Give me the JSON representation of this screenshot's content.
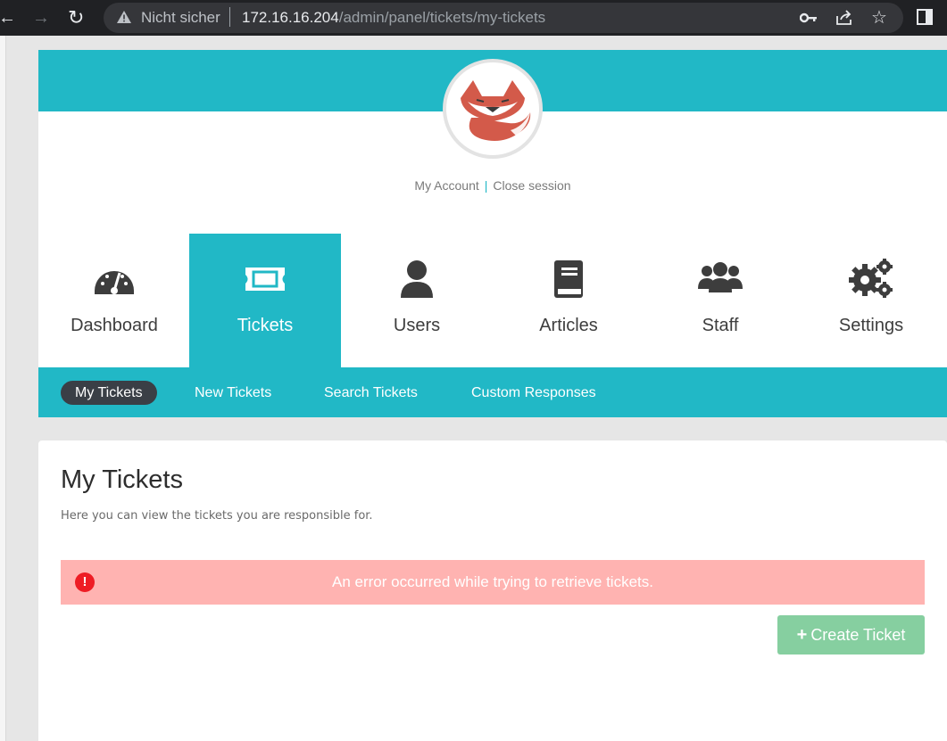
{
  "browser": {
    "security_text": "Nicht sicher",
    "url_host": "172.16.16.204",
    "url_path": "/admin/panel/tickets/my-tickets"
  },
  "account": {
    "my_account": "My Account",
    "divider": "|",
    "close_session": "Close session"
  },
  "nav": {
    "items": [
      {
        "label": "Dashboard",
        "icon": "dashboard-gauge-icon"
      },
      {
        "label": "Tickets",
        "icon": "ticket-icon",
        "active": true
      },
      {
        "label": "Users",
        "icon": "user-icon"
      },
      {
        "label": "Articles",
        "icon": "book-icon"
      },
      {
        "label": "Staff",
        "icon": "users-group-icon"
      },
      {
        "label": "Settings",
        "icon": "gears-icon"
      }
    ]
  },
  "subnav": {
    "items": [
      {
        "label": "My Tickets",
        "active": true
      },
      {
        "label": "New Tickets"
      },
      {
        "label": "Search Tickets"
      },
      {
        "label": "Custom Responses"
      }
    ]
  },
  "main": {
    "title": "My Tickets",
    "description": "Here you can view the tickets you are responsible for.",
    "error_message": "An error occurred while trying to retrieve tickets.",
    "create_button": "Create Ticket"
  },
  "colors": {
    "brand": "#21b8c6",
    "subnav_active": "#3a3f46",
    "error_bg": "#ffb3b1",
    "error_icon": "#ee1c24",
    "create_button": "#86cfa0"
  }
}
